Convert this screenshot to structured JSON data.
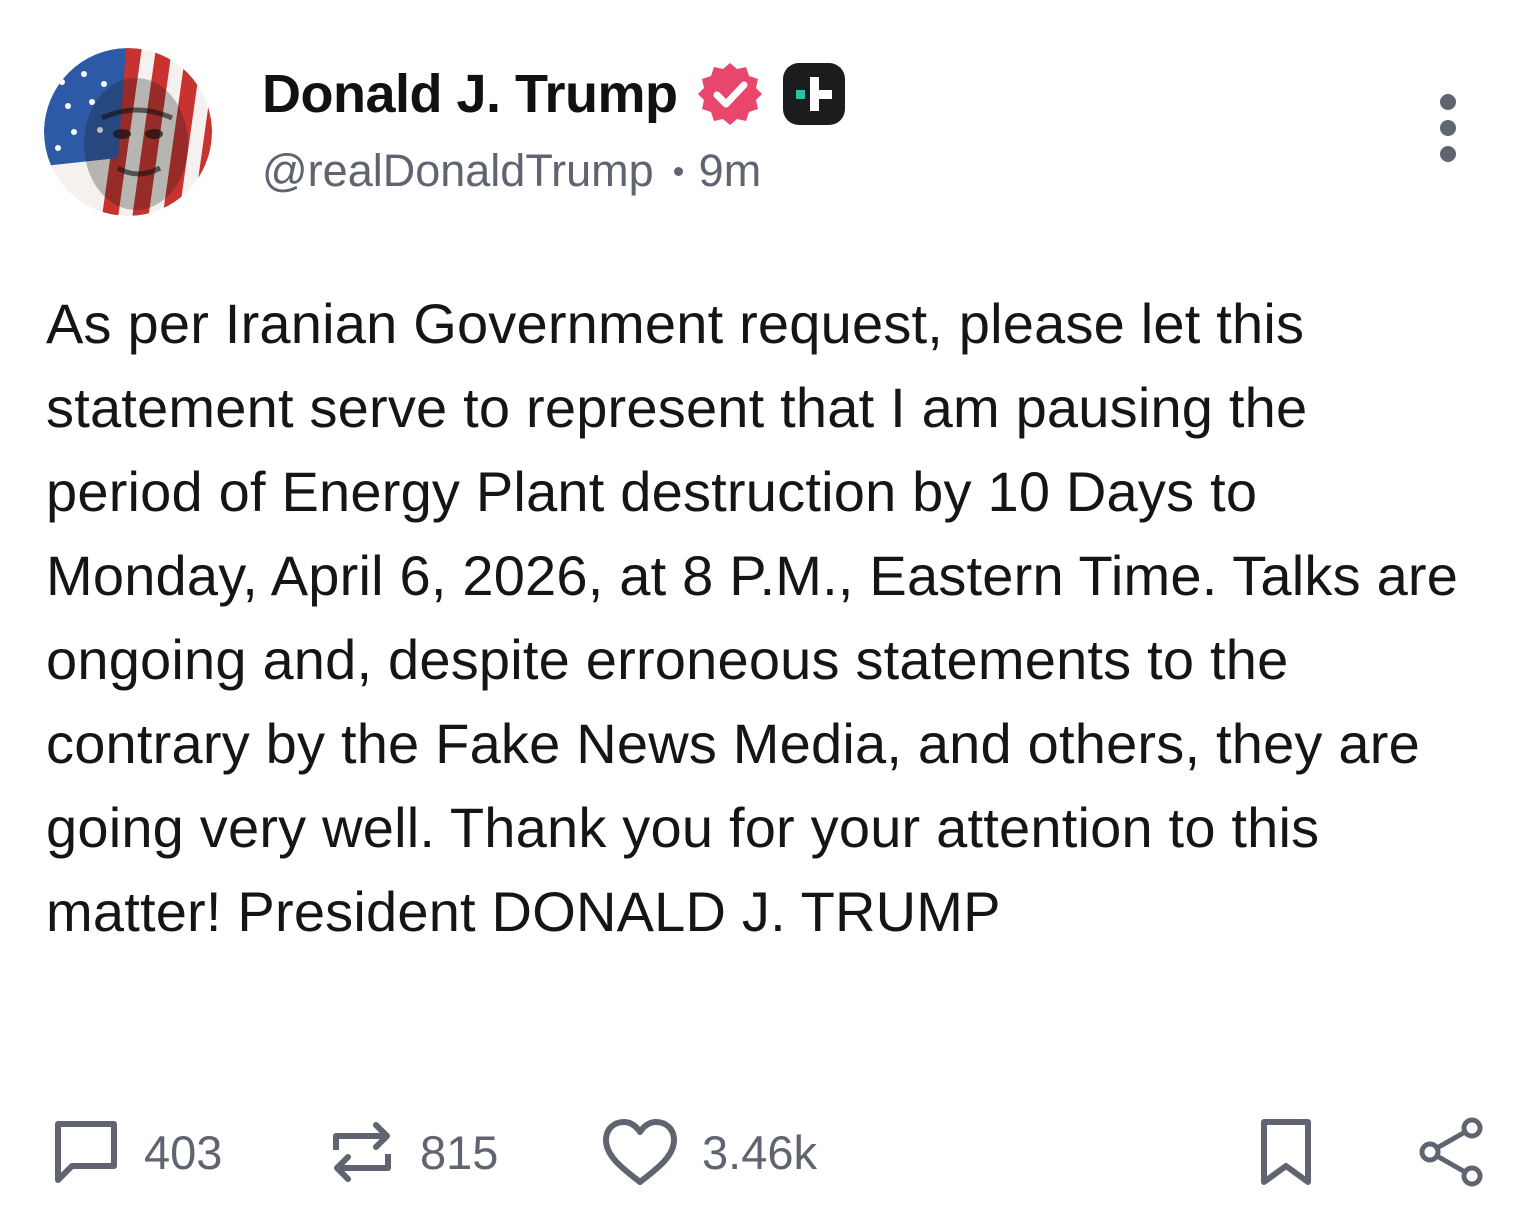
{
  "author": {
    "display_name": "Donald J. Trump",
    "handle": "@realDonaldTrump",
    "time_ago": "9m",
    "verified_badge": "verified-badge-icon",
    "plus_badge": "plus-badge-icon"
  },
  "menu": {
    "icon": "more-options-icon"
  },
  "post": {
    "text": "As per Iranian Government request, please let this statement serve to represent that I am pausing the period of Energy Plant destruction by 10 Days to Monday, April 6, 2026, at 8 P.M., Eastern Time. Talks are ongoing and, despite erroneous statements to the contrary by the Fake News Media, and others, they are going very well. Thank you for your attention to this matter! President DONALD J. TRUMP"
  },
  "actions": {
    "reply_count": "403",
    "repost_count": "815",
    "like_count": "3.46k"
  },
  "colors": {
    "verified": "#e8476b",
    "badge_dark": "#1c1c1f",
    "badge_accent": "#21c6a4",
    "muted_text": "#5f6470"
  }
}
